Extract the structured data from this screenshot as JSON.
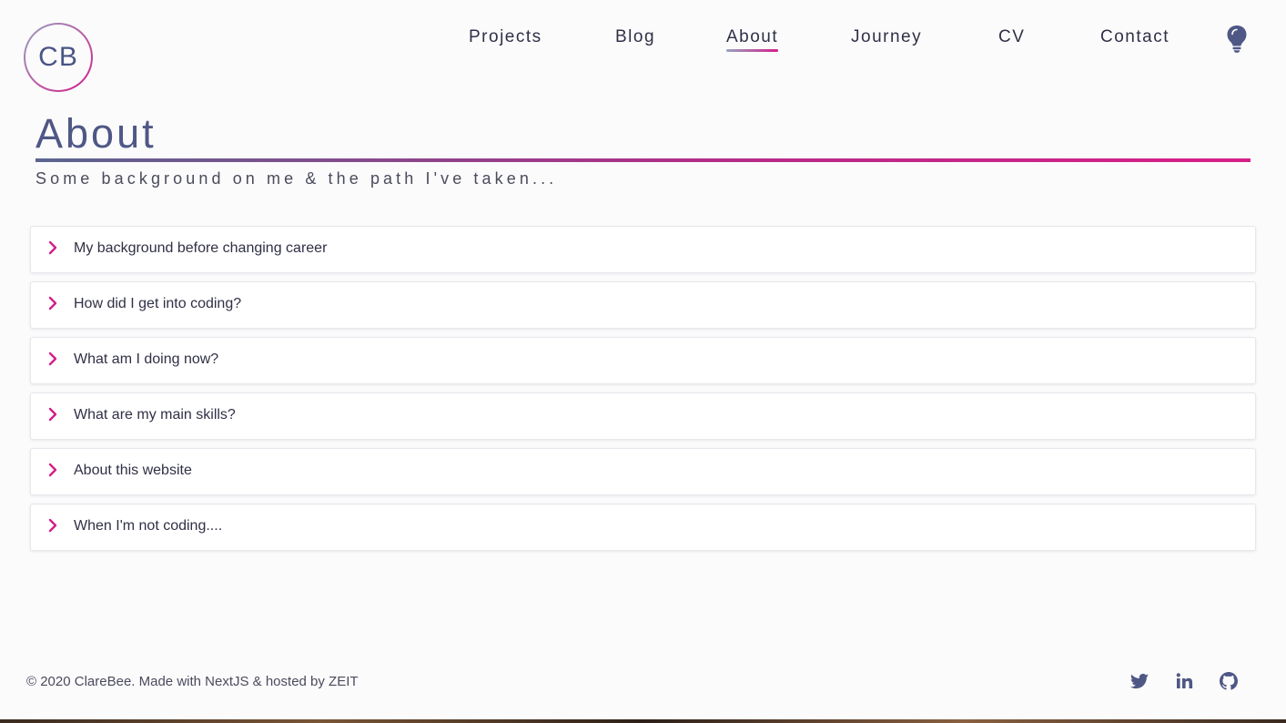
{
  "brand": {
    "logo_text": "CB"
  },
  "nav": {
    "items": [
      {
        "label": "Projects"
      },
      {
        "label": "Blog"
      },
      {
        "label": "About"
      },
      {
        "label": "Journey"
      },
      {
        "label": "CV"
      },
      {
        "label": "Contact"
      }
    ],
    "active": "About",
    "theme_icon": "lightbulb-icon"
  },
  "header": {
    "title": "About",
    "subtitle": "Some background on me & the path I've taken..."
  },
  "accordion": {
    "icon": "chevron-right-icon",
    "items": [
      {
        "label": "My background before changing career",
        "expanded": false
      },
      {
        "label": "How did I get into coding?",
        "expanded": false
      },
      {
        "label": "What am I doing now?",
        "expanded": false
      },
      {
        "label": "What are my main skills?",
        "expanded": false
      },
      {
        "label": "About this website",
        "expanded": false
      },
      {
        "label": "When I'm not coding....",
        "expanded": false
      }
    ]
  },
  "footer": {
    "text": "© 2020 ClareBee. Made with NextJS & hosted by ZEIT",
    "social": [
      "twitter-icon",
      "linkedin-icon",
      "github-icon"
    ]
  },
  "colors": {
    "accent": "#d21f8a",
    "primary": "#4f5885",
    "text": "#2f3047",
    "background": "#fcfbfc"
  }
}
